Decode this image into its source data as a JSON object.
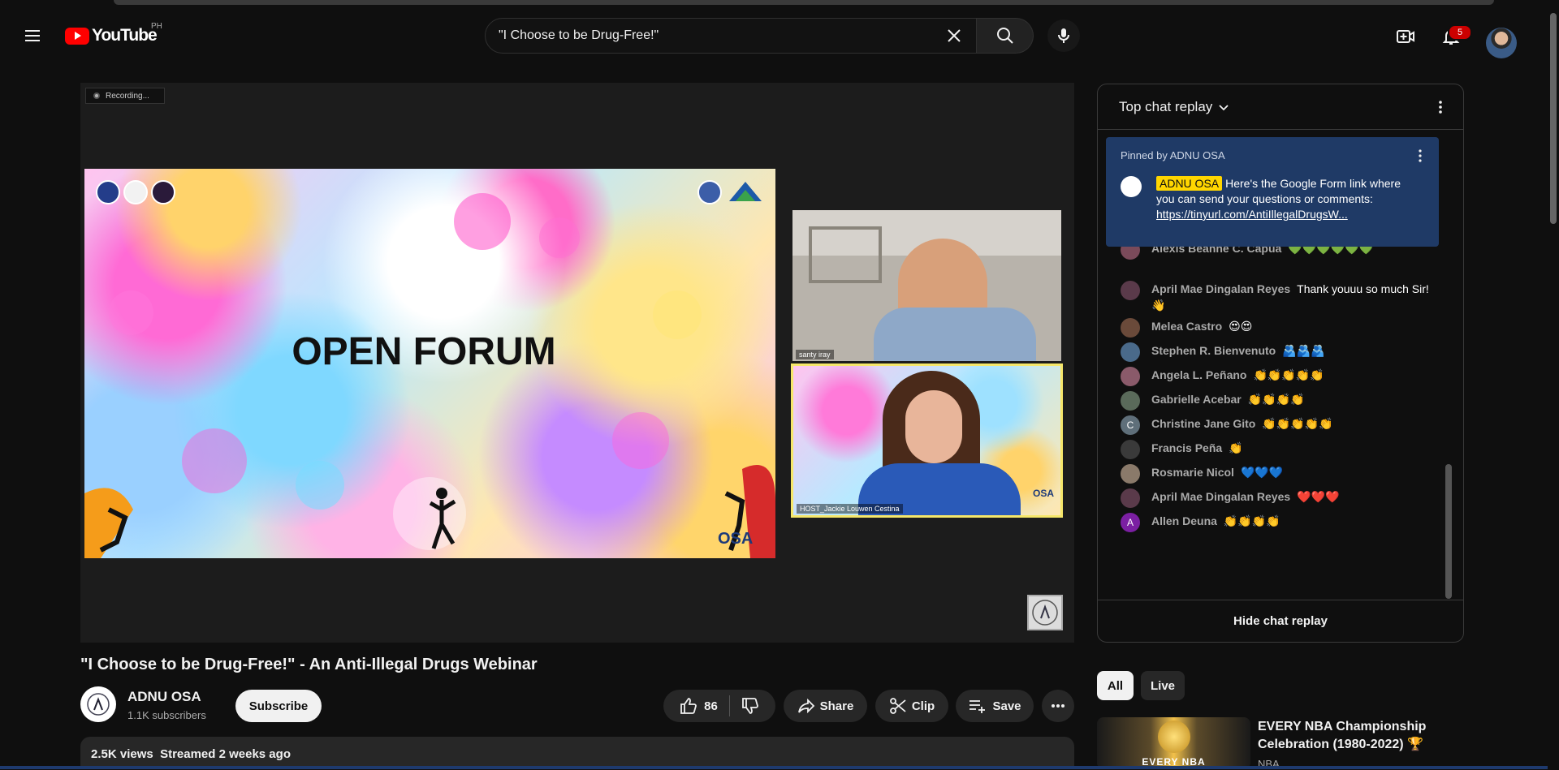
{
  "header": {
    "logo_text": "YouTube",
    "country_code": "PH",
    "search_value": "\"I Choose to be Drug-Free!\"",
    "notification_count": "5"
  },
  "video": {
    "recording_label": "Recording...",
    "slide_title": "OPEN FORUM",
    "slide_brand": "OSA",
    "cam1_name": "santy iray",
    "cam2_name": "HOST_Jackie Louwen Cestina",
    "cam2_brand": "OSA",
    "title": "\"I Choose to be Drug-Free!\" - An Anti-Illegal Drugs Webinar",
    "channel": "ADNU OSA",
    "subscribers": "1.1K subscribers",
    "subscribe_label": "Subscribe",
    "likes": "86",
    "share_label": "Share",
    "clip_label": "Clip",
    "save_label": "Save",
    "views": "2.5K views",
    "streamed": "Streamed 2 weeks ago"
  },
  "chat": {
    "header": "Top chat replay",
    "pinned_by": "Pinned by ADNU OSA",
    "pinned_author": "ADNU OSA",
    "pinned_text": "Here's the Google Form link where you can send your questions or comments: ",
    "pinned_link": "https://tinyurl.com/AntiIllegalDrugsW...",
    "messages": [
      {
        "author": "Alexis Beanne C. Capua",
        "text": "💚💚💚💚💚💚",
        "avatar_color": "#7a4a5a",
        "initial": ""
      },
      {
        "author": "April Mae Dingalan Reyes",
        "text": "Thank youuu so much Sir! 👋",
        "avatar_color": "#5a3a4a",
        "initial": ""
      },
      {
        "author": "Melea Castro",
        "text": "😍😍",
        "avatar_color": "#6a4a3a",
        "initial": ""
      },
      {
        "author": "Stephen R. Bienvenuto",
        "text": "🫂🫂🫂",
        "avatar_color": "#4a6a8a",
        "initial": ""
      },
      {
        "author": "Angela L. Peñano",
        "text": "👏👏👏👏👏",
        "avatar_color": "#8a5a6a",
        "initial": ""
      },
      {
        "author": "Gabrielle Acebar",
        "text": "👏👏👏👏",
        "avatar_color": "#5a6a5a",
        "initial": ""
      },
      {
        "author": "Christine Jane Gito",
        "text": "👏👏👏👏👏",
        "avatar_color": "#5f6f7a",
        "initial": "C"
      },
      {
        "author": "Francis Peña",
        "text": "👏",
        "avatar_color": "#3a3a3a",
        "initial": ""
      },
      {
        "author": "Rosmarie Nicol",
        "text": "💙💙💙",
        "avatar_color": "#8a7a6a",
        "initial": ""
      },
      {
        "author": "April Mae Dingalan Reyes",
        "text": "❤️❤️❤️",
        "avatar_color": "#5a3a4a",
        "initial": ""
      },
      {
        "author": "Allen Deuna",
        "text": "👏👏👏👏",
        "avatar_color": "#7b1fa2",
        "initial": "A"
      }
    ],
    "hide_label": "Hide chat replay"
  },
  "related": {
    "chips": [
      "All",
      "Live"
    ],
    "title": "EVERY NBA Championship Celebration (1980-2022) 🏆",
    "channel": "NBA",
    "thumb_text": "EVERY NBA"
  },
  "colors": {
    "accent_red": "#ff0000",
    "pinned_bg": "#1f3a66",
    "chip_yellow": "#ffd600"
  }
}
